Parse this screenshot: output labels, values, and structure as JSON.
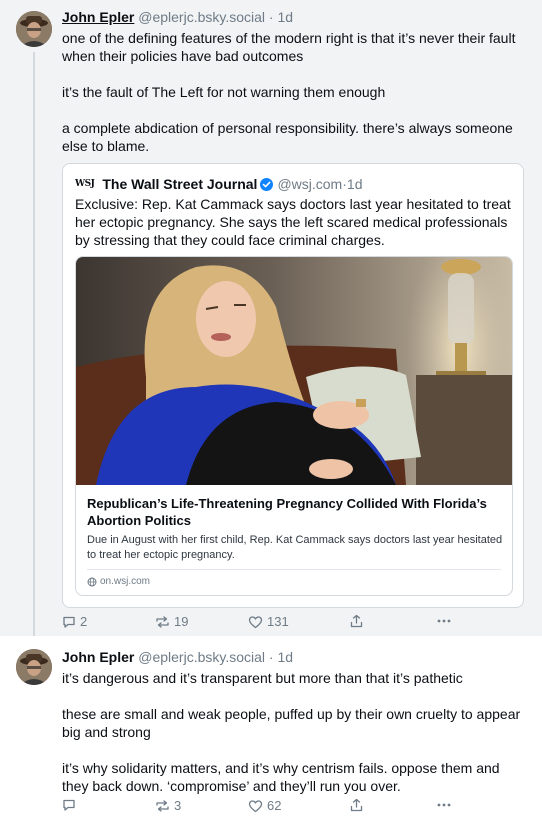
{
  "posts": [
    {
      "author": {
        "display_name": "John Epler",
        "handle": "@eplerjc.bsky.social",
        "separator": " · ",
        "time": "1d"
      },
      "paragraphs": [
        "one of the defining features of the modern right is that it’s never their fault when their policies have bad outcomes",
        "it’s the fault of The Left for not warning them enough",
        "a complete abdication of personal responsibility. there’s always someone else to blame."
      ],
      "quote": {
        "logo_text": "WSJ",
        "display_name": "The Wall Street Journal",
        "handle": "@wsj.com",
        "separator": " · ",
        "time": "1d",
        "text": "Exclusive: Rep. Kat Cammack says doctors last year hesitated to treat her ectopic pregnancy. She says the left scared medical professionals by stressing that they could face criminal charges.",
        "card": {
          "title": "Republican’s Life-Threatening Pregnancy Collided With Florida’s Abortion Politics",
          "description": "Due in August with her first child, Rep. Kat Cammack says doctors last year hesitated to treat her ectopic pregnancy.",
          "domain": "on.wsj.com"
        }
      },
      "actions": {
        "replies": "2",
        "reposts": "19",
        "likes": "131"
      }
    },
    {
      "author": {
        "display_name": "John Epler",
        "handle": "@eplerjc.bsky.social",
        "separator": " · ",
        "time": "1d"
      },
      "paragraphs": [
        "it’s dangerous and it’s transparent but more than that it’s pathetic",
        "these are small and weak people, puffed up by their own cruelty to appear big and strong",
        "it’s why solidarity matters, and it’s why centrism fails. oppose them and they back down. ‘compromise’ and they’ll run you over."
      ],
      "actions": {
        "replies": "",
        "reposts": "3",
        "likes": "62"
      }
    }
  ],
  "colors": {
    "thread_bg": "#f1f3f5",
    "verified": "#1083fe",
    "muted": "#6f7b86",
    "border": "#d4d9de"
  },
  "icons": [
    "reply-icon",
    "repost-icon",
    "like-icon",
    "share-icon",
    "more-icon",
    "verified-icon",
    "globe-icon"
  ]
}
